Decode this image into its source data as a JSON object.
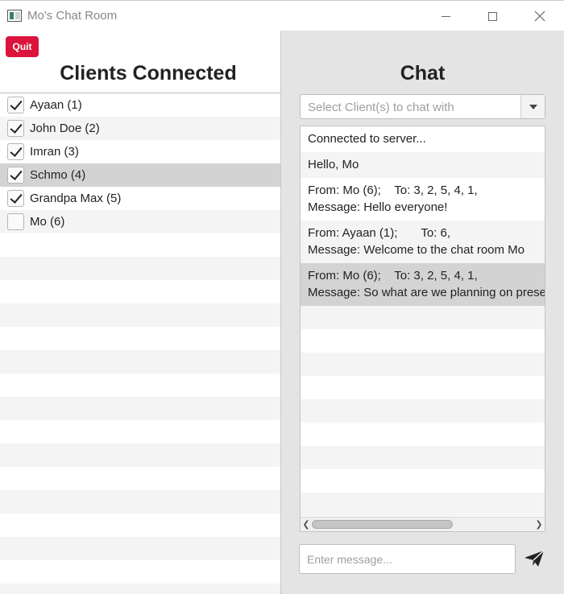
{
  "window": {
    "title": "Mo's Chat Room"
  },
  "left": {
    "quit_label": "Quit",
    "heading": "Clients Connected",
    "clients": [
      {
        "label": "Ayaan (1)",
        "checked": true
      },
      {
        "label": "John Doe (2)",
        "checked": true
      },
      {
        "label": "Imran (3)",
        "checked": true
      },
      {
        "label": "Schmo (4)",
        "checked": true,
        "selected": true
      },
      {
        "label": "Grandpa Max (5)",
        "checked": true
      },
      {
        "label": "Mo (6)",
        "checked": false
      }
    ]
  },
  "right": {
    "heading": "Chat",
    "recipient_select": {
      "placeholder": "Select Client(s) to chat with"
    },
    "messages": [
      {
        "line1": "Connected to server..."
      },
      {
        "line1": "Hello, Mo"
      },
      {
        "line1": "From: Mo (6);    To: 3, 2, 5, 4, 1,",
        "line2": "Message: Hello everyone!"
      },
      {
        "line1": "From: Ayaan (1);       To: 6,",
        "line2": "Message: Welcome to the chat room Mo"
      },
      {
        "line1": "From: Mo (6);    To: 3, 2, 5, 4, 1,",
        "line2": "Message: So what are we planning on preser",
        "selected": true
      }
    ],
    "message_input": {
      "placeholder": "Enter message...",
      "value": ""
    }
  },
  "icons": {
    "send": "paper-plane-icon",
    "app": "app-window-icon"
  }
}
